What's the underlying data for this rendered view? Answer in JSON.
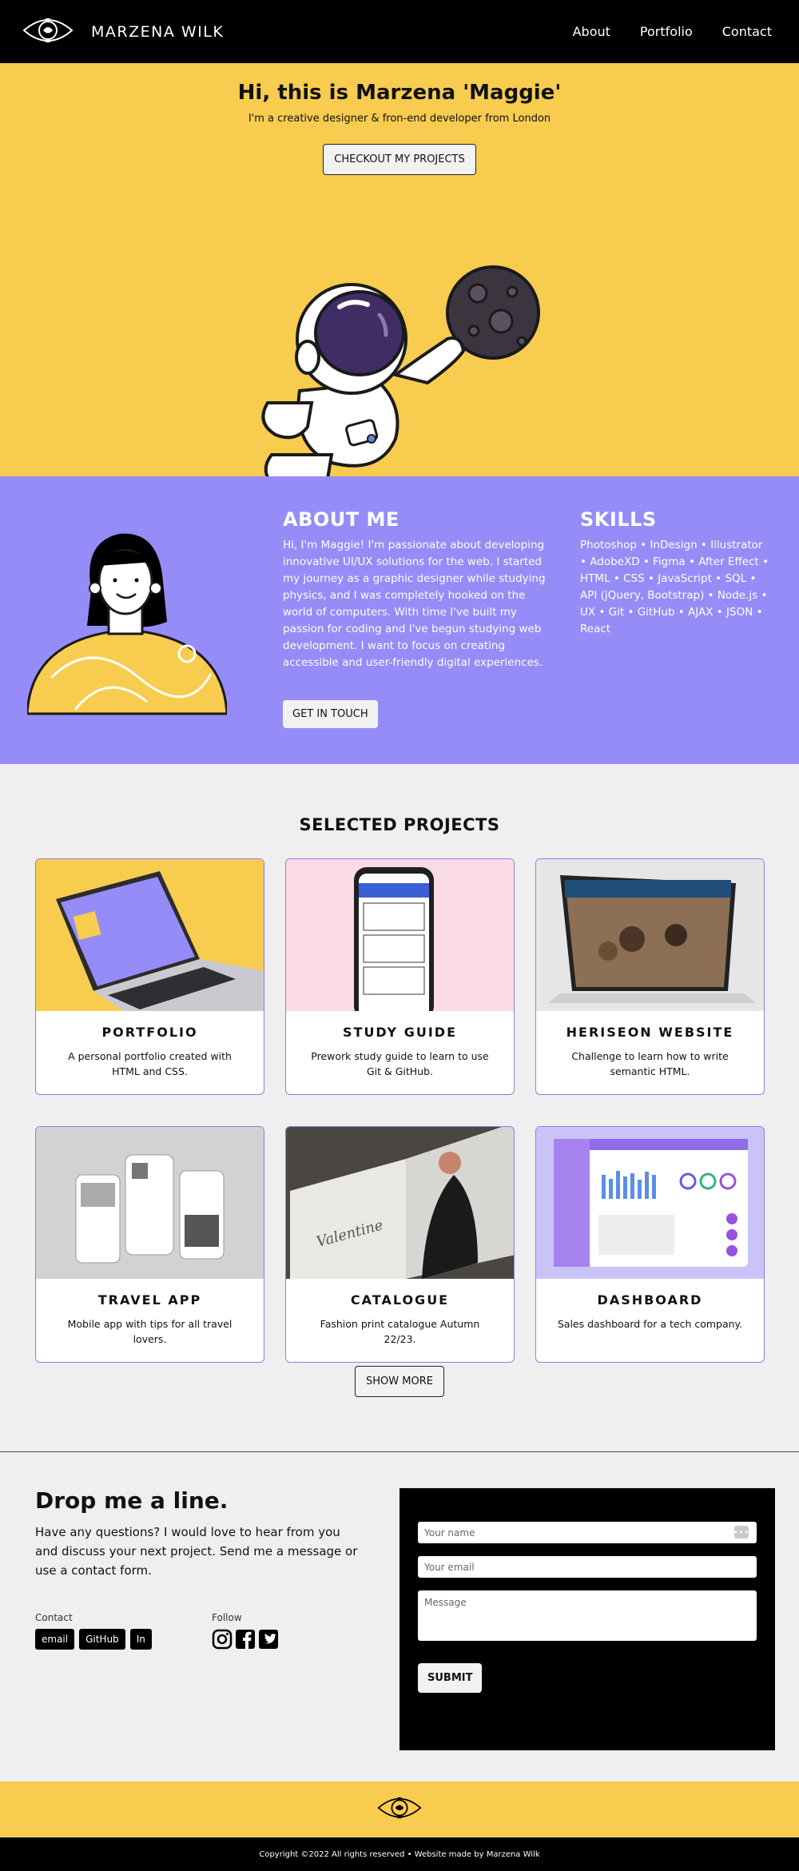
{
  "header": {
    "brand": "MARZENA WILK",
    "nav": [
      "About",
      "Portfolio",
      "Contact"
    ]
  },
  "hero": {
    "title": "Hi, this is Marzena 'Maggie'",
    "subtitle": "I'm a creative designer & fron-end developer from London",
    "cta": "CHECKOUT MY PROJECTS"
  },
  "about": {
    "heading": "ABOUT ME",
    "text": "Hi, I'm Maggie! I'm passionate about developing innovative UI/UX solutions for the web. I started my journey as a graphic designer while studying physics, and I was completely hooked on the world of computers. With time I've built my passion for coding and I've begun studying web development. I want to focus on creating accessible and user-friendly digital experiences.",
    "cta": "GET IN TOUCH"
  },
  "skills": {
    "heading": "SKILLS",
    "text": "Photoshop • InDesign • Illustrator • AdobeXD • Figma • After Effect • HTML • CSS • JavaScript • SQL • API (jQuery, Bootstrap) • Node.js • UX • Git • GitHub • AJAX • JSON • React"
  },
  "projects": {
    "heading": "SELECTED PROJECTS",
    "items": [
      {
        "title": "PORTFOLIO",
        "desc": "A personal portfolio created with HTML and CSS."
      },
      {
        "title": "STUDY GUIDE",
        "desc": "Prework study guide to learn to use Git & GitHub."
      },
      {
        "title": "HERISEON WEBSITE",
        "desc": "Challenge to learn how to write semantic HTML."
      },
      {
        "title": "TRAVEL APP",
        "desc": "Mobile app with tips for all travel lovers."
      },
      {
        "title": "CATALOGUE",
        "desc": "Fashion print catalogue Autumn 22/23."
      },
      {
        "title": "DASHBOARD",
        "desc": "Sales dashboard for a tech company."
      }
    ],
    "more": "SHOW MORE"
  },
  "contact": {
    "heading": "Drop me a line.",
    "lead": "Have any questions? I would love to hear from you and discuss your next project. Send me a message or use a contact form.",
    "contact_label": "Contact",
    "follow_label": "Follow",
    "links": [
      "email",
      "GitHub",
      "In"
    ],
    "name_placeholder": "Your name",
    "email_placeholder": "Your email",
    "message_placeholder": "Message",
    "submit": "SUBMIT"
  },
  "footer": {
    "copyright": "Copyright ©2022 All rights reserved • Website made by Marzena Wilk"
  },
  "colors": {
    "yellow": "#f7cc4f",
    "purple": "#968cf7",
    "black": "#000000"
  }
}
